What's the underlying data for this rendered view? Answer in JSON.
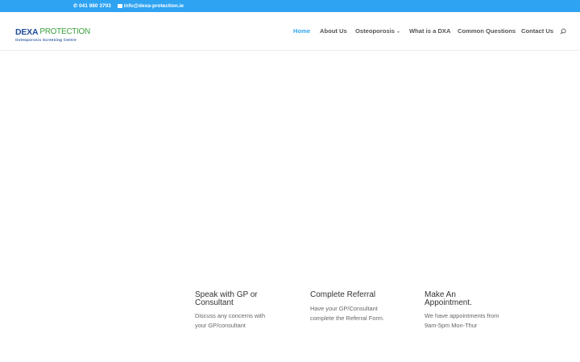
{
  "topbar": {
    "phone": "041 980 3703",
    "email": "info@dexa-protection.ie",
    "phone_icon": "phone-icon",
    "email_icon": "envelope-icon",
    "bg_color": "#2ea3f2"
  },
  "logo": {
    "main_left": "DEXA",
    "main_right": "PROTECTION",
    "tagline": "Osteoporosis Screening Centre"
  },
  "nav": {
    "items": [
      {
        "label": "Home",
        "active": true
      },
      {
        "label": "About Us"
      },
      {
        "label": "Osteoporosis",
        "has_dropdown": true
      },
      {
        "label": "What is a DXA"
      },
      {
        "label": "Common Questions"
      },
      {
        "label": "Contact Us"
      }
    ],
    "search_icon": "search-icon",
    "accent_color": "#2ea3f2"
  },
  "steps": [
    {
      "title": "Speak with GP or Consultant",
      "text": "Discuss any concerns with your GP/consultant"
    },
    {
      "title": "Complete Referral",
      "text": "Have your GP/Consultant complete the Referral Form."
    },
    {
      "title": "Make An Appointment.",
      "text": "We have appointments from 9am-5pm Mon-Thur"
    }
  ]
}
